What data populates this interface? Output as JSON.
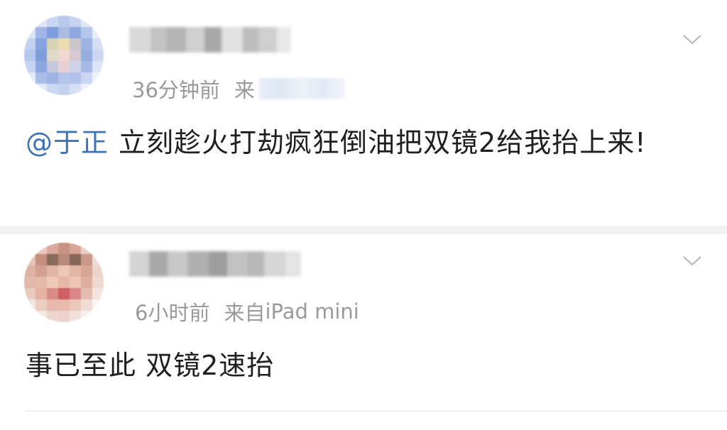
{
  "comments": [
    {
      "username": "",
      "time": "36分钟前",
      "source_prefix": "来",
      "mention": "@于正",
      "text": "立刻趁火打劫疯狂倒油把双镜2给我抬上来!"
    },
    {
      "username": "",
      "time": "6小时前",
      "source_prefix": "来自",
      "source": "iPad mini",
      "text": "事已至此 双镜2速抬"
    }
  ],
  "icons": {
    "expand": "chevron-down-icon"
  },
  "colors": {
    "mention": "#3f73b7",
    "meta": "#9a9a9a",
    "background": "#ffffff",
    "separator": "#f2f2f2"
  }
}
